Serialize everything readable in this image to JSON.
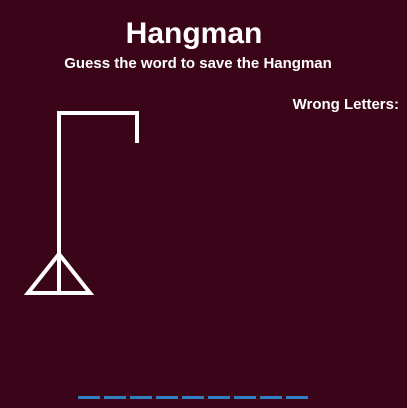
{
  "header": {
    "title": "Hangman",
    "subtitle": "Guess the word to save the Hangman"
  },
  "wrong_letters": {
    "label": "Wrong Letters:",
    "letters": ""
  },
  "game": {
    "word_length": 9,
    "revealed": [
      "",
      "",
      "",
      "",
      "",
      "",
      "",
      "",
      ""
    ],
    "wrong_count": 0
  },
  "colors": {
    "background": "#3a0519",
    "text": "#ffffff",
    "gallows": "#ffffff",
    "word_slot": "#2f7fc4"
  }
}
